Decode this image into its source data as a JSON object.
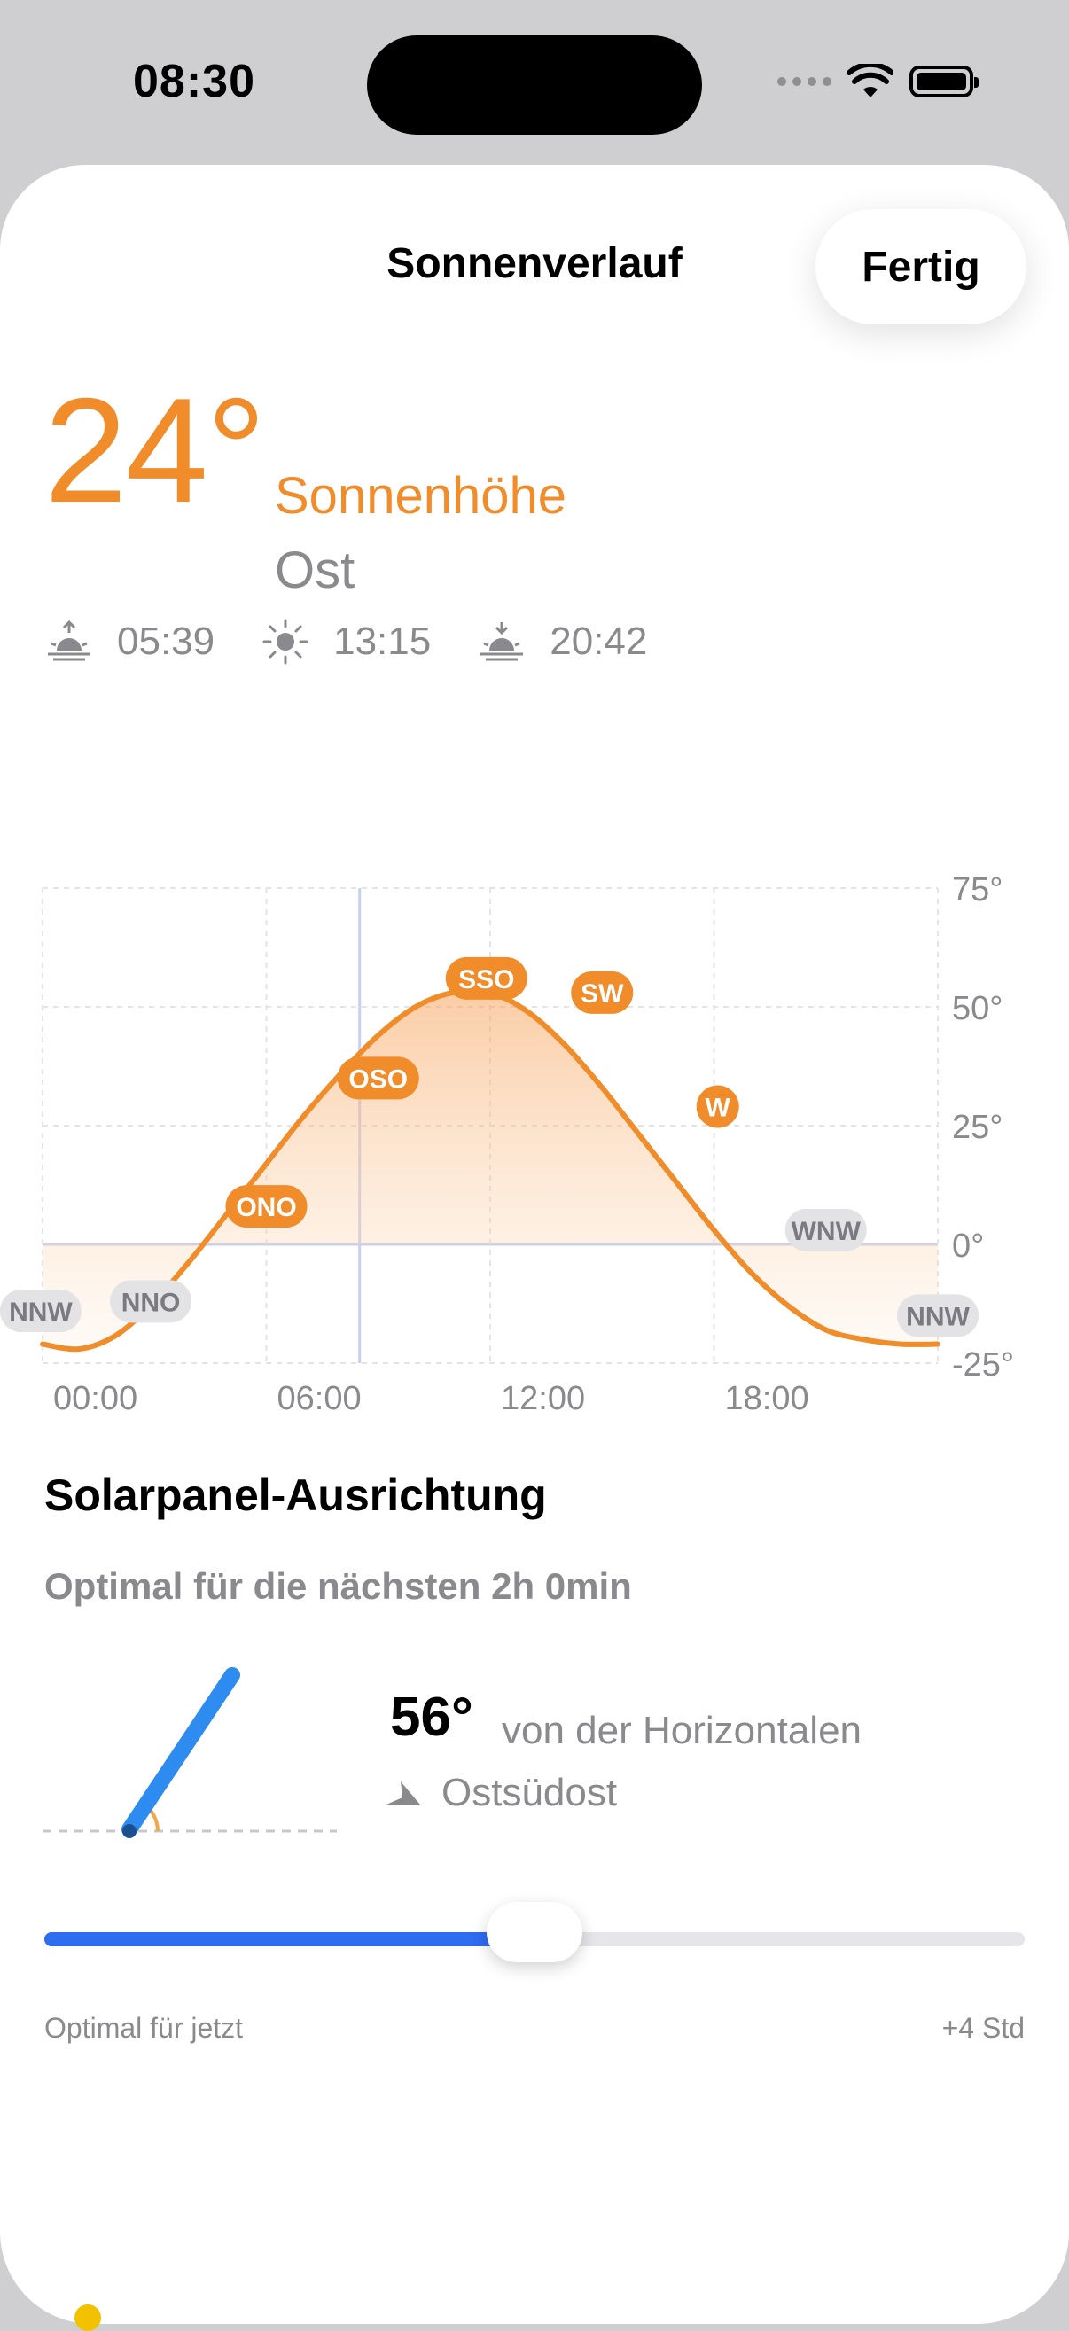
{
  "status_bar": {
    "time": "08:30"
  },
  "sheet": {
    "title": "Sonnenverlauf",
    "done_label": "Fertig"
  },
  "sun": {
    "altitude": "24°",
    "altitude_label": "Sonnenhöhe",
    "direction": "Ost",
    "sunrise": "05:39",
    "solar_noon": "13:15",
    "sunset": "20:42"
  },
  "chart_data": {
    "type": "area",
    "xlabel": "",
    "ylabel": "",
    "x_ticks": [
      "00:00",
      "06:00",
      "12:00",
      "18:00"
    ],
    "y_ticks": [
      "75°",
      "50°",
      "25°",
      "0°",
      "-25°"
    ],
    "ylim": [
      -25,
      75
    ],
    "xlim": [
      0,
      24
    ],
    "current_time": 8.5,
    "points": [
      {
        "x": 0,
        "y": -21
      },
      {
        "x": 1,
        "y": -22
      },
      {
        "x": 2,
        "y": -19
      },
      {
        "x": 3,
        "y": -12
      },
      {
        "x": 4,
        "y": -3
      },
      {
        "x": 5,
        "y": 7
      },
      {
        "x": 6,
        "y": 17
      },
      {
        "x": 7,
        "y": 27
      },
      {
        "x": 8,
        "y": 36
      },
      {
        "x": 9,
        "y": 44
      },
      {
        "x": 10,
        "y": 50
      },
      {
        "x": 11,
        "y": 53
      },
      {
        "x": 12,
        "y": 53
      },
      {
        "x": 13,
        "y": 49
      },
      {
        "x": 14,
        "y": 42
      },
      {
        "x": 15,
        "y": 33
      },
      {
        "x": 16,
        "y": 23
      },
      {
        "x": 17,
        "y": 13
      },
      {
        "x": 18,
        "y": 3
      },
      {
        "x": 19,
        "y": -6
      },
      {
        "x": 20,
        "y": -13
      },
      {
        "x": 21,
        "y": -18
      },
      {
        "x": 22,
        "y": -20
      },
      {
        "x": 23,
        "y": -21
      },
      {
        "x": 24,
        "y": -21
      }
    ],
    "direction_labels": [
      {
        "label": "NNW",
        "x": -0.05,
        "y": -14,
        "above_horizon": false
      },
      {
        "label": "NNO",
        "x": 2.9,
        "y": -12,
        "above_horizon": false
      },
      {
        "label": "ONO",
        "x": 6.0,
        "y": 8,
        "above_horizon": true
      },
      {
        "label": "OSO",
        "x": 9.0,
        "y": 35,
        "above_horizon": true
      },
      {
        "label": "SSO",
        "x": 11.9,
        "y": 56,
        "above_horizon": true
      },
      {
        "label": "SW",
        "x": 15.0,
        "y": 53,
        "above_horizon": true
      },
      {
        "label": "W",
        "x": 18.1,
        "y": 29,
        "above_horizon": true
      },
      {
        "label": "WNW",
        "x": 21.0,
        "y": 3,
        "above_horizon": false
      },
      {
        "label": "NNW",
        "x": 24.0,
        "y": -15,
        "above_horizon": false
      }
    ],
    "colors": {
      "curve": "#f08c2a",
      "label_active": "#f08c2a",
      "label_inactive": "#e3e3e6",
      "now_line": "#c9cff0"
    }
  },
  "solar_panel": {
    "title": "Solarpanel-Ausrichtung",
    "subtitle": "Optimal für die nächsten 2h 0min",
    "tilt": "56°",
    "tilt_desc": "von der Horizontalen",
    "direction": "Ostsüdost",
    "slider": {
      "value_fraction": 0.5,
      "left_label": "Optimal für jetzt",
      "right_label": "+4 Std"
    }
  },
  "colors": {
    "accent": "#f08c2a",
    "panel_blue": "#2e8cf0",
    "slider_blue": "#2e6cf0"
  }
}
